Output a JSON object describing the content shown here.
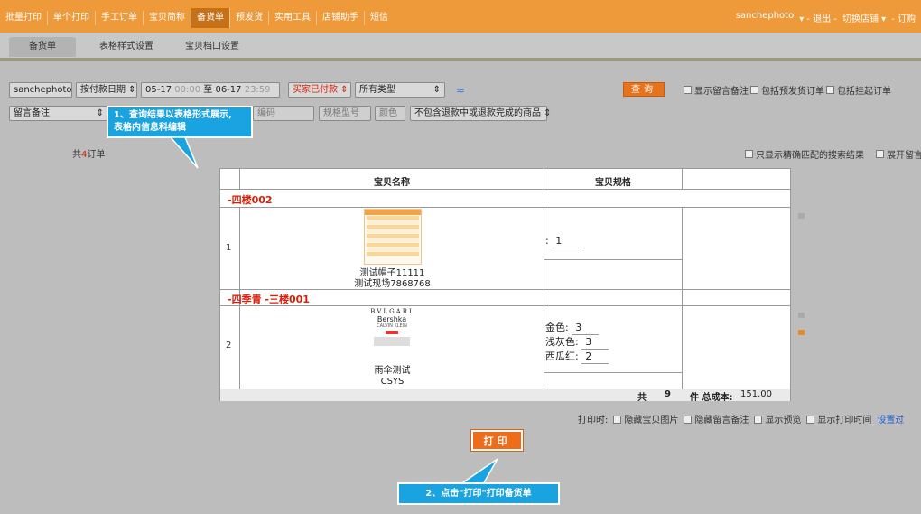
{
  "topnav": {
    "items": [
      "批量打印",
      "单个打印",
      "手工订单",
      "宝贝简称",
      "备货单",
      "预发货",
      "实用工具",
      "店铺助手",
      "短信"
    ],
    "active_index": 4,
    "user": "sanchephoto",
    "links": [
      "▾ - 退出 -",
      "切换店铺 ▾",
      "- 订购"
    ]
  },
  "subtabs": [
    "备货单",
    "表格样式设置",
    "宝贝档口设置"
  ],
  "filters": {
    "shop": "sanchephoto",
    "date_type": "按付款日期 ⇕",
    "date_range_start": "05-17",
    "date_range_start_time": "00:00",
    "date_range_sep": "至",
    "date_range_end": "06-17",
    "date_range_end_time": "23:59",
    "status": "买家已付款 ⇕",
    "type": "所有类型",
    "type_arrow": "⇕",
    "collapse": "≈",
    "query": "查询",
    "show_note": "显示留言备注",
    "include_presale": "包括预发货订单",
    "include_hold": "包括挂起订单",
    "note_select": "留言备注",
    "note_arrow": "⇕",
    "code": "编码",
    "spec_no": "规格型号",
    "color": "颜色",
    "refund_filter": "不包含退款中或退款完成的商品 ⇕"
  },
  "results": {
    "count_prefix": "共",
    "count": "4",
    "count_suffix": "订单",
    "exact_match": "只显示精确匹配的搜索结果",
    "expand_note": "展开留言"
  },
  "callouts": {
    "one_line1": "1、查询结果以表格形式展示,",
    "one_line2": "表格内信息科编辑",
    "two": "2、点击\"打印\"打印备货单"
  },
  "table": {
    "headers": [
      "宝贝名称",
      "宝贝规格"
    ],
    "groups": [
      {
        "name": "-四楼002",
        "index": "1",
        "product_line1": "测试帽子11111",
        "product_line2": "测试现场7868768",
        "specs": [
          {
            "label": "",
            "qty": "1"
          }
        ]
      },
      {
        "name": "-四季青 -三楼001",
        "index": "2",
        "product_line1": "雨伞测试",
        "product_line2": "CSYS",
        "thumb_brand1": "BVLGARI",
        "thumb_brand2": "Bershka",
        "thumb_brand3": "CALVIN KLEIN",
        "specs": [
          {
            "label": "金色",
            "qty": "3"
          },
          {
            "label": "浅灰色",
            "qty": "3"
          },
          {
            "label": "西瓜红",
            "qty": "2"
          }
        ]
      }
    ],
    "total_prefix": "共",
    "total_qty": "9",
    "total_unit": "件 总成本:",
    "total_cost": "151.00"
  },
  "print": {
    "label": "打印时:",
    "hide_images": "隐藏宝贝图片",
    "hide_notes": "隐藏留言备注",
    "show_preview": "显示预览",
    "show_time": "显示打印时间",
    "settings": "设置过",
    "button": "打印"
  },
  "colors": {
    "accent": "#ee9a3a",
    "callout": "#19a3e0",
    "red": "#d81e06"
  }
}
